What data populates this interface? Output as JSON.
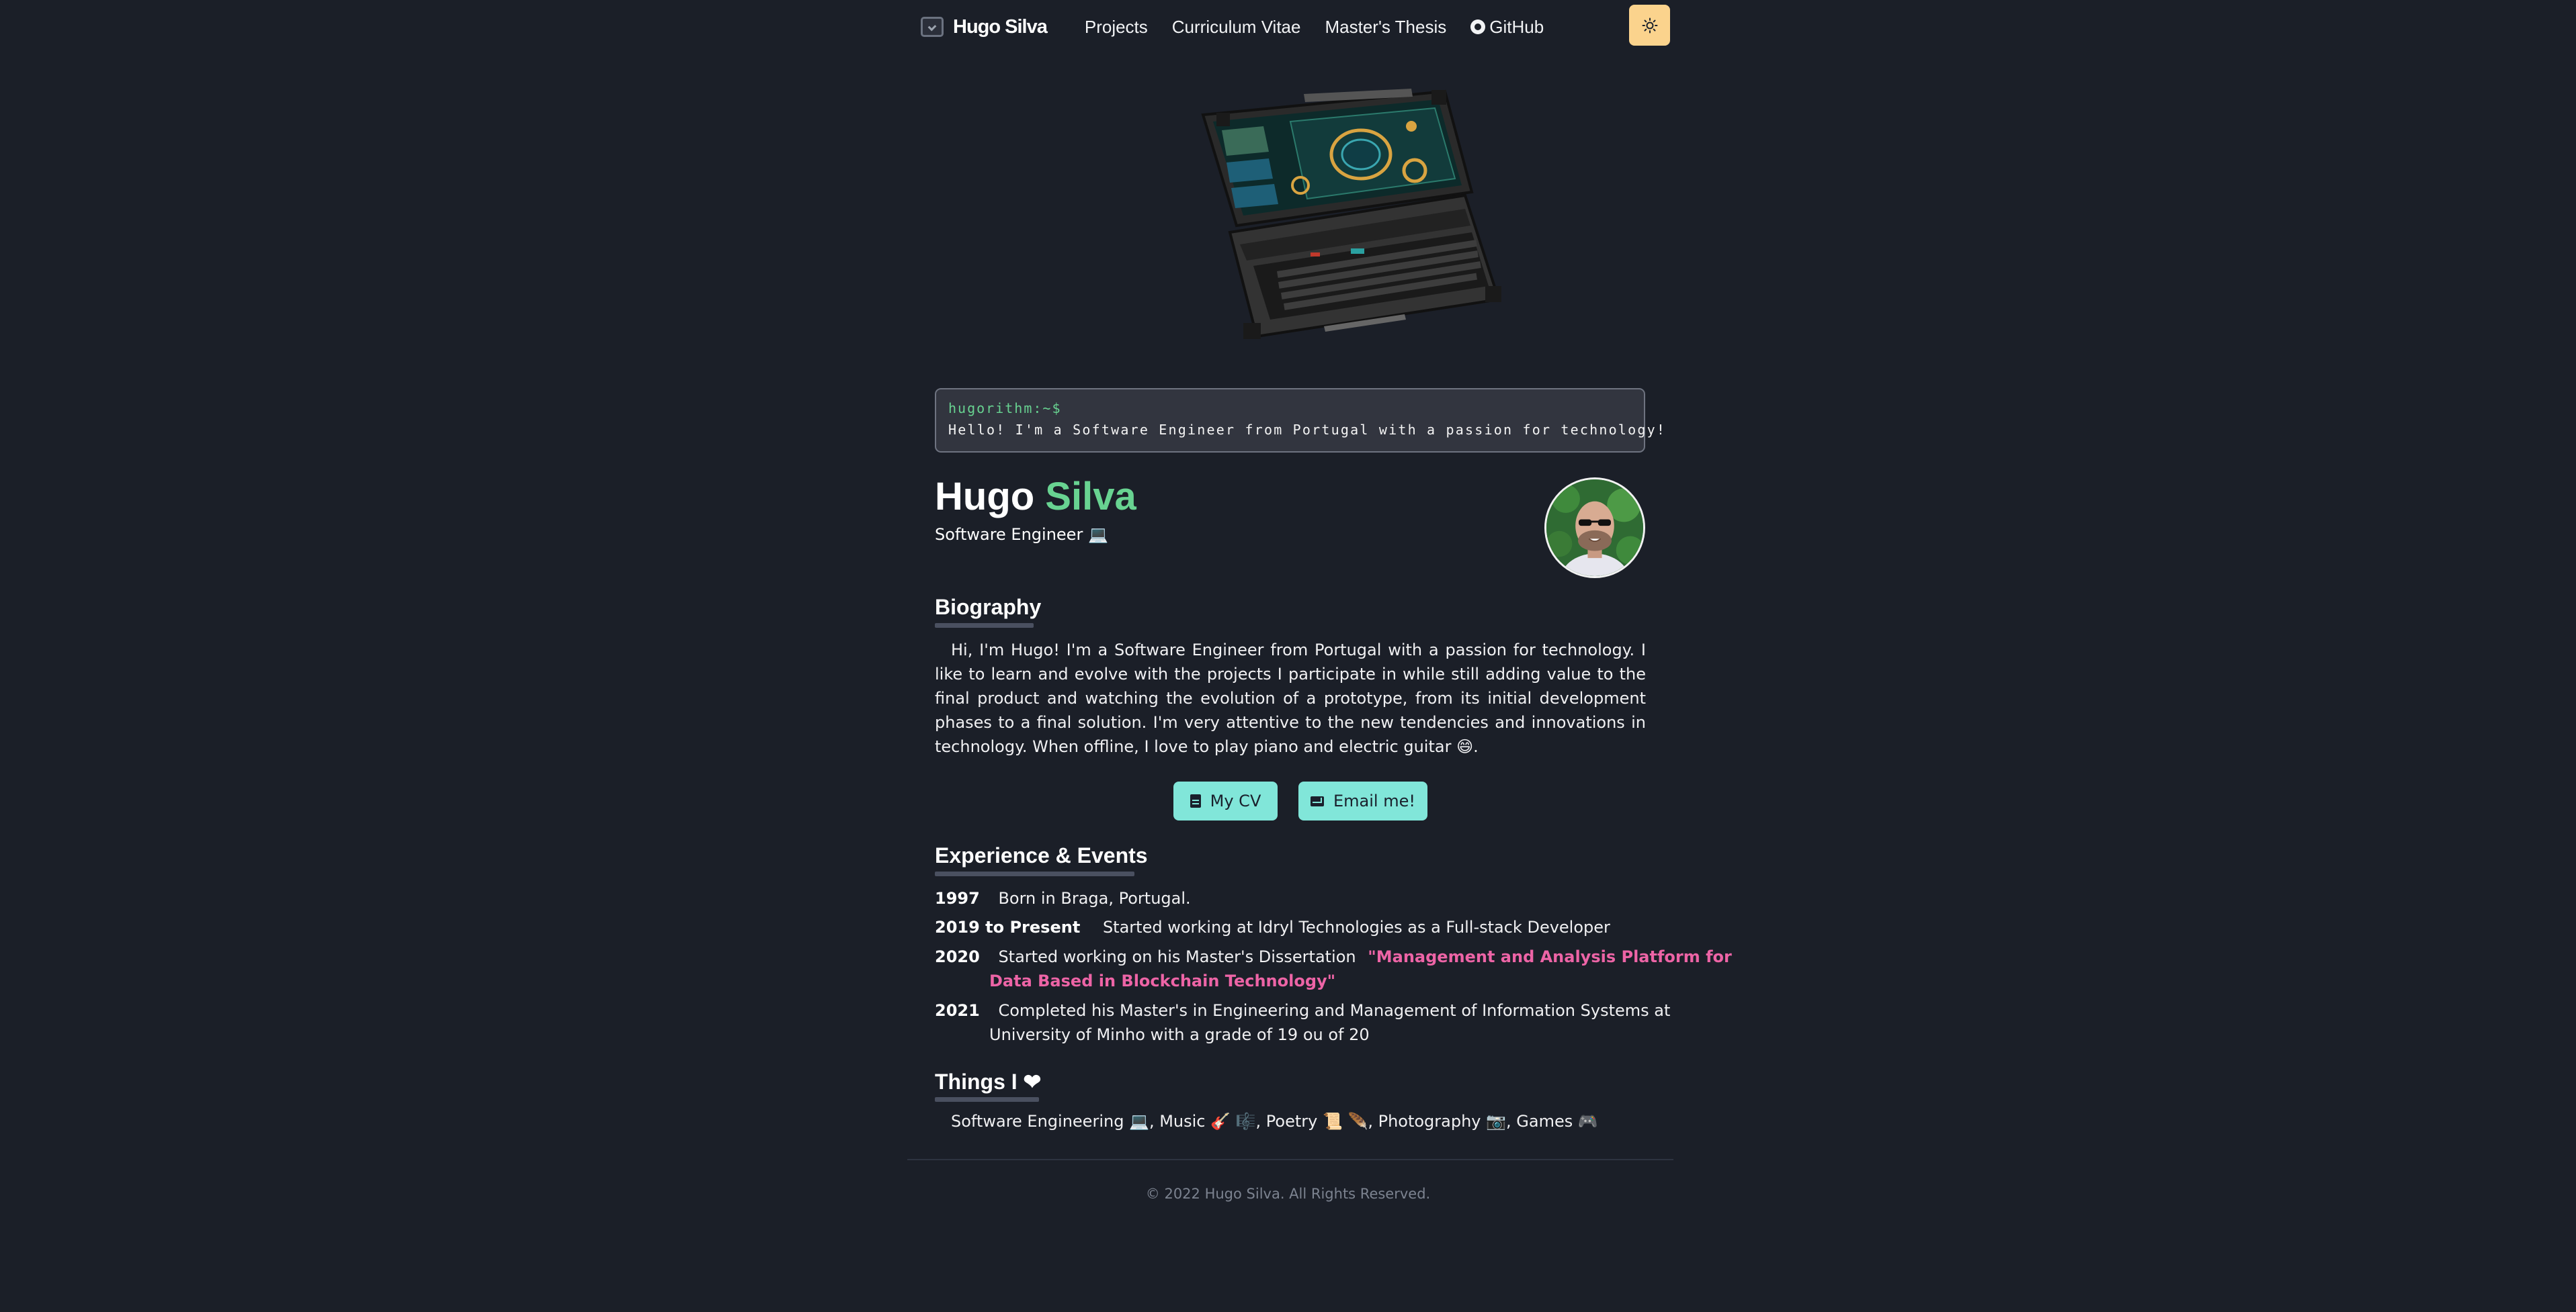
{
  "nav": {
    "brand": "Hugo Silva",
    "links": [
      "Projects",
      "Curriculum Vitae",
      "Master's Thesis",
      "GitHub"
    ],
    "theme_icon": "sun-icon"
  },
  "terminal": {
    "prompt": "hugorithm:~$",
    "text": "Hello! I'm a Software Engineer from Portugal with a passion for technology!"
  },
  "profile": {
    "first_name": "Hugo",
    "last_name": "Silva",
    "role": "Software Engineer 💻"
  },
  "biography": {
    "title": "Biography",
    "text": "Hi, I'm Hugo! I'm a Software Engineer from Portugal with a passion for technology. I like to learn and evolve with the projects I participate in while still adding value to the final product and watching the evolution of a prototype, from its initial development phases to a final solution. I'm very attentive to the new tendencies and innovations in technology. When offline, I love to play piano and electric guitar 😄."
  },
  "buttons": {
    "cv": "My CV",
    "email": "Email me!"
  },
  "experience": {
    "title": "Experience & Events",
    "items": [
      {
        "year": "1997",
        "text": "Born in Braga, Portugal."
      },
      {
        "year": "2019 to Present",
        "text": "Started working at Idryl Technologies as a Full-stack Developer"
      },
      {
        "year": "2020",
        "text": "Started working on his Master's Dissertation",
        "highlight_1": "\"Management and Analysis Platform for",
        "highlight_2": "Data Based in Blockchain Technology\""
      },
      {
        "year": "2021",
        "text_1": "Completed his Master's in Engineering and Management of Information Systems at",
        "text_2": "University of Minho with a grade of 19 ou of 20"
      }
    ]
  },
  "things": {
    "title": "Things I ❤",
    "text": "Software Engineering 💻, Music 🎸 🎼, Poetry 📜 🪶, Photography 📷, Games 🎮"
  },
  "footer": "© 2022 Hugo Silva. All Rights Reserved.",
  "colors": {
    "background": "#1b1f28",
    "accent_green": "#68d391",
    "button_teal": "#81e6d9",
    "theme_button": "#fbd38d",
    "highlight_pink": "#ed64a6"
  }
}
